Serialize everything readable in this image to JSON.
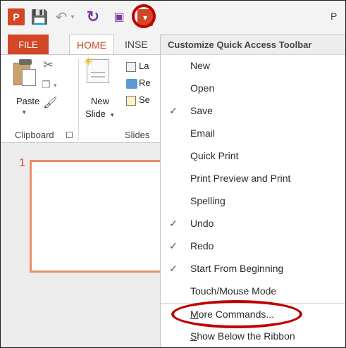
{
  "title_bar": {
    "logo": "P",
    "save_icon": "save-icon",
    "undo_icon": "undo-icon",
    "redo_icon": "redo-icon",
    "present_icon": "start-from-beginning-icon",
    "dropdown_icon": "customize-toolbar-dropdown-icon",
    "title_text": "P"
  },
  "tabs": {
    "file": "FILE",
    "home": "HOME",
    "insert": "INSE"
  },
  "ribbon": {
    "clipboard": {
      "paste_label": "Paste",
      "group_label": "Clipboard"
    },
    "slides": {
      "new_slide_line1": "New",
      "new_slide_line2": "Slide",
      "layout_partial": "La",
      "reset_partial": "Re",
      "section_partial": "Se",
      "group_label": "Slides"
    }
  },
  "slide_panel": {
    "slide_number": "1"
  },
  "menu": {
    "header": "Customize Quick Access Toolbar",
    "items": [
      {
        "label": "New",
        "checked": false
      },
      {
        "label": "Open",
        "checked": false
      },
      {
        "label": "Save",
        "checked": true
      },
      {
        "label": "Email",
        "checked": false
      },
      {
        "label": "Quick Print",
        "checked": false
      },
      {
        "label": "Print Preview and Print",
        "checked": false
      },
      {
        "label": "Spelling",
        "checked": false
      },
      {
        "label": "Undo",
        "checked": true
      },
      {
        "label": "Redo",
        "checked": true
      },
      {
        "label": "Start From Beginning",
        "checked": true
      },
      {
        "label": "Touch/Mouse Mode",
        "checked": false
      }
    ],
    "more_commands": {
      "underline": "M",
      "rest": "ore Commands..."
    },
    "show_below": {
      "underline": "S",
      "rest": "how Below the Ribbon"
    },
    "check_glyph": "✓"
  },
  "colors": {
    "accent": "#d24726",
    "highlight_ring": "#c00000",
    "qat_purple": "#7a3aa0"
  }
}
